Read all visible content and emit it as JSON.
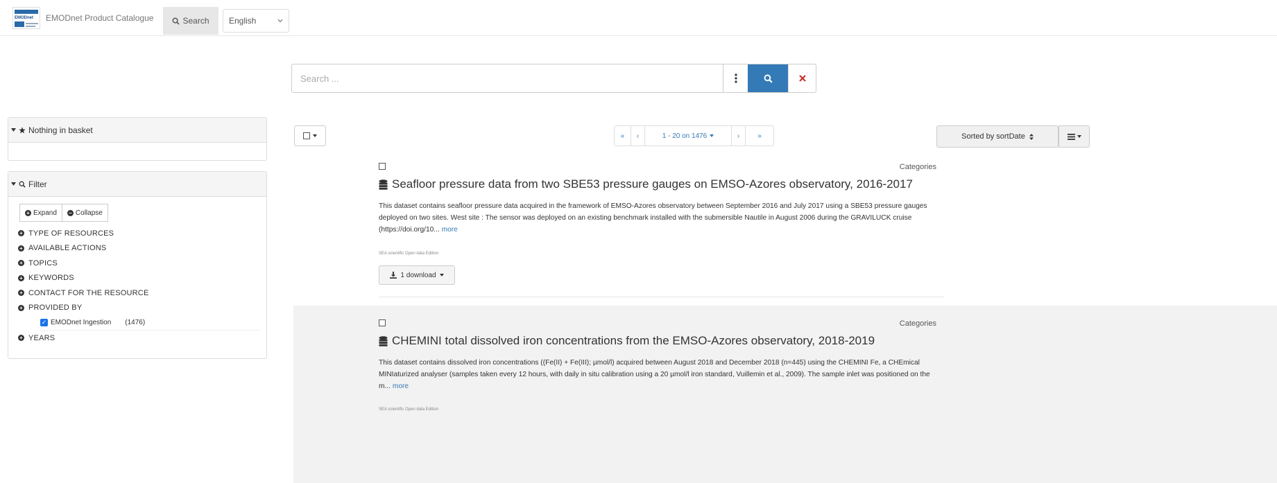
{
  "navbar": {
    "brand_title": "EMODnet Product Catalogue",
    "logo_text": "EMODnet",
    "search_tab": "Search",
    "language": "English"
  },
  "search": {
    "placeholder": "Search ...",
    "more_icon": "vertical-dots-icon",
    "go_icon": "search-icon",
    "clear_icon": "close-icon"
  },
  "basket": {
    "label": "Nothing in basket"
  },
  "filter": {
    "label": "Filter",
    "expand": "Expand",
    "collapse": "Collapse",
    "facets": [
      "TYPE OF RESOURCES",
      "AVAILABLE ACTIONS",
      "TOPICS",
      "KEYWORDS",
      "CONTACT FOR THE RESOURCE",
      "PROVIDED BY",
      "YEARS"
    ],
    "provided_by_item": {
      "label": "EMODnet Ingestion",
      "count": "(1476)",
      "checked": true
    }
  },
  "toolbar": {
    "pager": {
      "first": "«",
      "prev": "‹",
      "range": "1 - 20 on 1476",
      "next": "›",
      "last": "»"
    },
    "sort_label": "Sorted by sortDate",
    "view_icon": "list-icon"
  },
  "results": [
    {
      "title": "Seafloor pressure data from two SBE53 pressure gauges on EMSO-Azores observatory, 2016-2017",
      "categories": "Categories",
      "description": "This dataset contains seafloor pressure data acquired in the framework of EMSO-Azores observatory between September 2016 and July 2017 using a SBE53 pressure gauges deployed on two sites. West site : The sensor was deployed on an existing benchmark installed with the submersible Nautile in August 2006 during the GRAVILUCK cruise (https://doi.org/10...",
      "more": "more",
      "org": "SEA scientific Open data Edition",
      "download": "1 download"
    },
    {
      "title": "CHEMINI total dissolved iron concentrations from the EMSO-Azores observatory, 2018-2019",
      "categories": "Categories",
      "description": "This dataset contains dissolved iron concentrations ((Fe(II) + Fe(III); µmol/l) acquired between August 2018 and December 2018 (n=445) using the CHEMINI Fe, a CHEmical MINIaturized analyser (samples taken every 12 hours, with daily in situ calibration using a 20 µmol/l iron standard, Vuillemin et al., 2009). The sample inlet was positioned on the m...",
      "more": "more",
      "org": "SEA scientific Open data Edition"
    }
  ]
}
